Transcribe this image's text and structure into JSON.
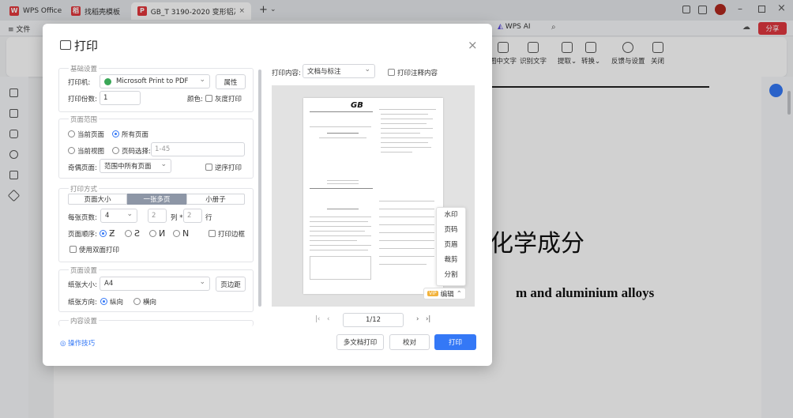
{
  "tabs": [
    {
      "label": "WPS Office"
    },
    {
      "label": "找稻壳模板"
    },
    {
      "label": "GB_T 3190-2020 变形铝及铝"
    }
  ],
  "menubar": {
    "file": "文件",
    "wps_ai": "WPS AI",
    "share": "分享"
  },
  "ribbon": {
    "items": [
      {
        "label": "图中文字"
      },
      {
        "label": "识别文字"
      },
      {
        "label": "提取"
      },
      {
        "label": "转换"
      },
      {
        "label": "反馈与设置"
      },
      {
        "label": "关闭"
      }
    ]
  },
  "doc": {
    "heading": "化学成分",
    "subheading": "m and aluminium alloys"
  },
  "dialog": {
    "title": "打印",
    "basic": {
      "section": "基础设置",
      "printer_label": "打印机:",
      "printer": "Microsoft Print to PDF",
      "properties": "属性",
      "copies_label": "打印份数:",
      "copies": "1",
      "color_label": "颜色:",
      "grayscale": "灰度打印"
    },
    "range": {
      "section": "页面范围",
      "current_page": "当前页面",
      "all_pages": "所有页面",
      "current_view": "当前视图",
      "page_select": "页码选择:",
      "page_placeholder": "1-45",
      "odd_even_label": "奇偶页面:",
      "odd_even": "范围中所有页面",
      "reverse": "逆序打印"
    },
    "mode": {
      "section": "打印方式",
      "tabs": [
        {
          "label": "页面大小"
        },
        {
          "label": "一张多页"
        },
        {
          "label": "小册子"
        }
      ],
      "pages_per_sheet_label": "每张页数:",
      "pages_per_sheet": "4",
      "cols": "2",
      "col_label": "列 *",
      "rows": "2",
      "row_label": "行",
      "order_label": "页面顺序:",
      "border": "打印边框",
      "duplex": "使用双面打印"
    },
    "page_setup": {
      "section": "页面设置",
      "paper_label": "纸张大小:",
      "paper": "A4",
      "margins": "页边距",
      "orient_label": "纸张方向:",
      "portrait": "纵向",
      "landscape": "横向"
    },
    "content": {
      "section": "内容设置"
    },
    "tips": "操作技巧",
    "print_content_label": "打印内容:",
    "print_content": "文档与标注",
    "print_annotations": "打印注释内容",
    "preview": {
      "gb": "GB",
      "page_num": "1/12",
      "edit": "编辑",
      "vip": "VIP",
      "menu": [
        {
          "label": "水印"
        },
        {
          "label": "页码"
        },
        {
          "label": "页眉"
        },
        {
          "label": "裁剪"
        },
        {
          "label": "分割"
        }
      ]
    },
    "buttons": {
      "multi_doc": "多文档打印",
      "proofread": "校对",
      "print": "打印"
    }
  },
  "colors": {
    "accent": "#3478f6",
    "share": "#e0373f",
    "wps_red": "#e3383c"
  }
}
